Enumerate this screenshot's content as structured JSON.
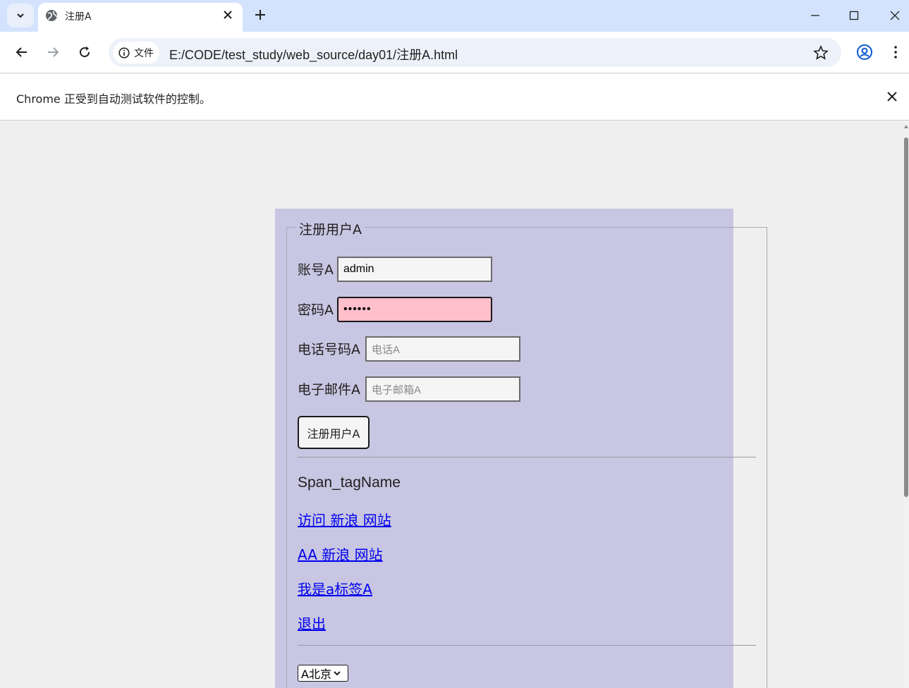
{
  "browser": {
    "tab_title": "注册A",
    "chip_label": "文件",
    "url": "E:/CODE/test_study/web_source/day01/注册A.html",
    "infobar_message": "Chrome 正受到自动测试软件的控制。"
  },
  "page": {
    "legend": "注册用户A",
    "account_label": "账号A",
    "account_value": "admin",
    "password_label": "密码A",
    "password_value": "••••••",
    "phone_label": "电话号码A",
    "phone_placeholder": "电话A",
    "email_label": "电子邮件A",
    "email_placeholder": "电子邮箱A",
    "submit_label": "注册用户A",
    "span_text": "Span_tagName",
    "links": [
      "访问 新浪 网站",
      "AA 新浪 网站",
      "我是a标签A",
      "退出"
    ],
    "select_value": "A北京"
  },
  "colors": {
    "tabstrip": "#d3e3fd",
    "form_bg": "#c8c6e2",
    "password_bg": "#ffc0cb",
    "link": "#0000ee"
  }
}
